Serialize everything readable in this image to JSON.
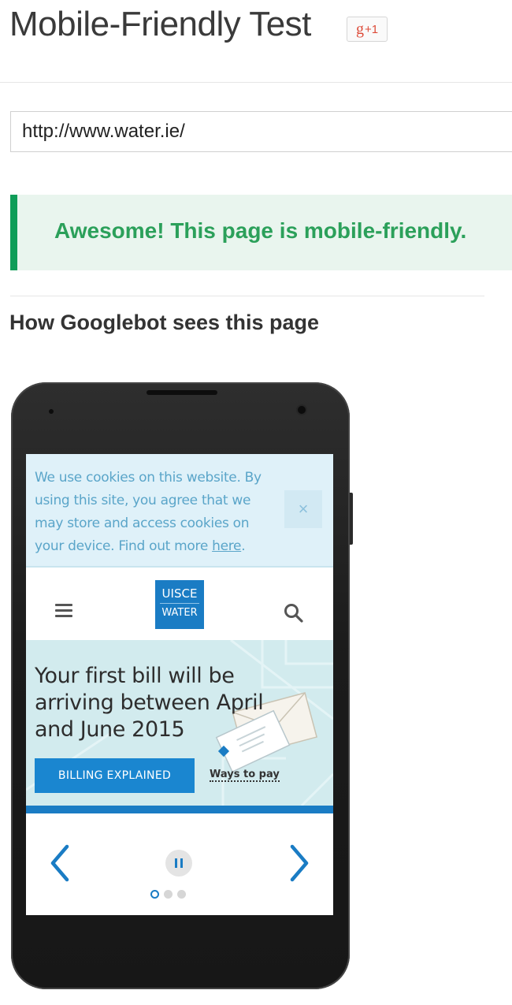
{
  "header": {
    "title": "Mobile-Friendly Test",
    "gplus_g": "g",
    "gplus_plus": "+1"
  },
  "url_input": {
    "value": "http://www.water.ie/"
  },
  "result": {
    "message": "Awesome! This page is mobile-friendly."
  },
  "section": {
    "heading": "How Googlebot sees this page"
  },
  "preview": {
    "cookie": {
      "text": "We use cookies on this website. By using this site, you agree that we may store and access cookies on your device. Find out more ",
      "link": "here",
      "end": ".",
      "close": "×"
    },
    "logo": {
      "line1": "UISCE",
      "line2": "WATER"
    },
    "hero": {
      "text": "Your first bill will be arriving between April and June 2015",
      "button": "BILLING EXPLAINED",
      "link": "Ways to pay"
    },
    "carousel": {
      "prev": "previous-arrow",
      "next": "next-arrow",
      "dots": 3,
      "active_dot": 0
    }
  },
  "colors": {
    "success_green": "#0f9d58",
    "success_text": "#2ba05a",
    "brand_blue": "#1a7cc4"
  }
}
